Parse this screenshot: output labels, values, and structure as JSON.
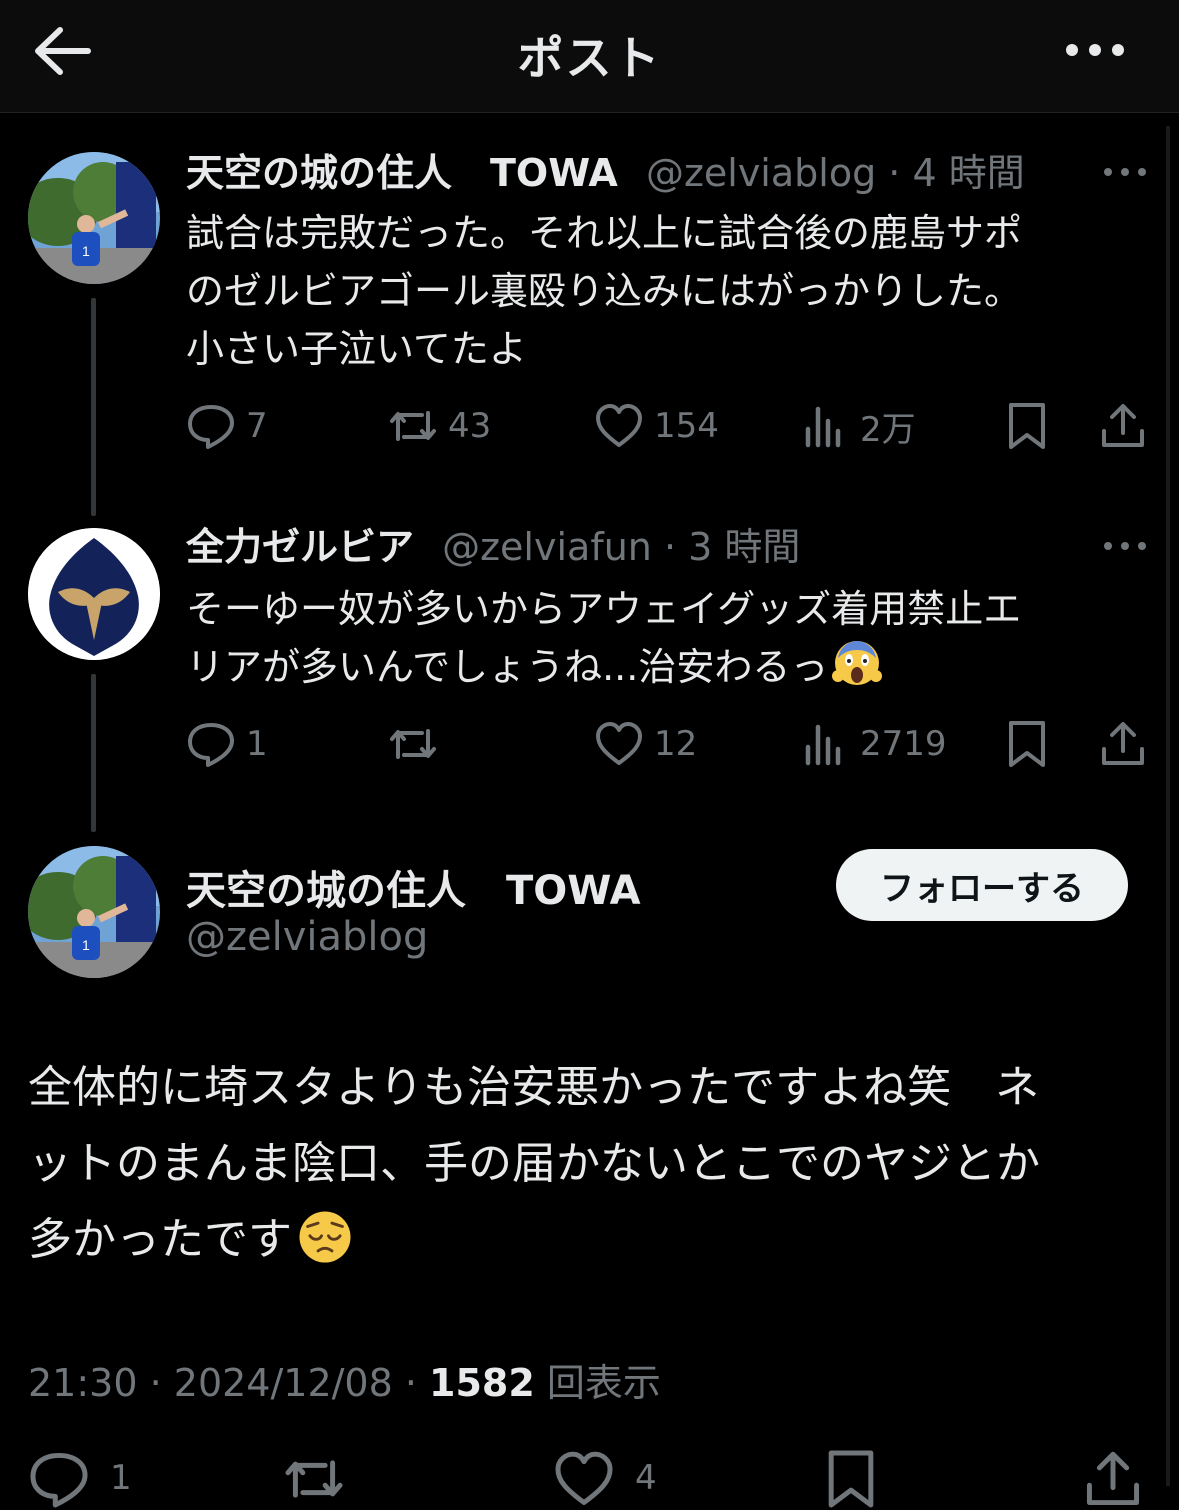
{
  "header": {
    "title": "ポスト",
    "back_icon": "arrow-left-icon",
    "more_icon": "more-horizontal-icon"
  },
  "tweets": [
    {
      "name": "天空の城の住人　TOWA",
      "handle": "@zelviablog",
      "sep": " · ",
      "time": "4 時間",
      "text": "試合は完敗だった。それ以上に試合後の鹿島サポ\nのゼルビアゴール裏殴り込みにはがっかりした。\n小さい子泣いてたよ",
      "replies": "7",
      "retweets": "43",
      "likes": "154",
      "views": "2万"
    },
    {
      "name": "全力ゼルビア",
      "handle": "@zelviafun",
      "sep": " · ",
      "time": "3 時間",
      "text": "そーゆー奴が多いからアウェイグッズ着用禁止エ\nリアが多いんでしょうね...治安わるっ",
      "emoji": "screaming-face-emoji",
      "replies": "1",
      "retweets": "",
      "likes": "12",
      "views": "2719"
    }
  ],
  "main": {
    "name": "天空の城の住人　TOWA",
    "handle": "@zelviablog",
    "follow_label": "フォローする",
    "text": "全体的に埼スタよりも治安悪かったですよね笑　ネ\nットのまんま陰口、手の届かないとこでのヤジとか\n多かったです",
    "emoji": "pensive-face-emoji",
    "time": "21:30",
    "sep1": " · ",
    "date": "2024/12/08",
    "sep2": " · ",
    "views_num": "1582",
    "views_label": " 回表示",
    "replies": "1",
    "likes": "4"
  },
  "colors": {
    "background": "#000000",
    "text": "#e7e9ea",
    "muted": "#71767b",
    "button_bg": "#eff3f4"
  }
}
